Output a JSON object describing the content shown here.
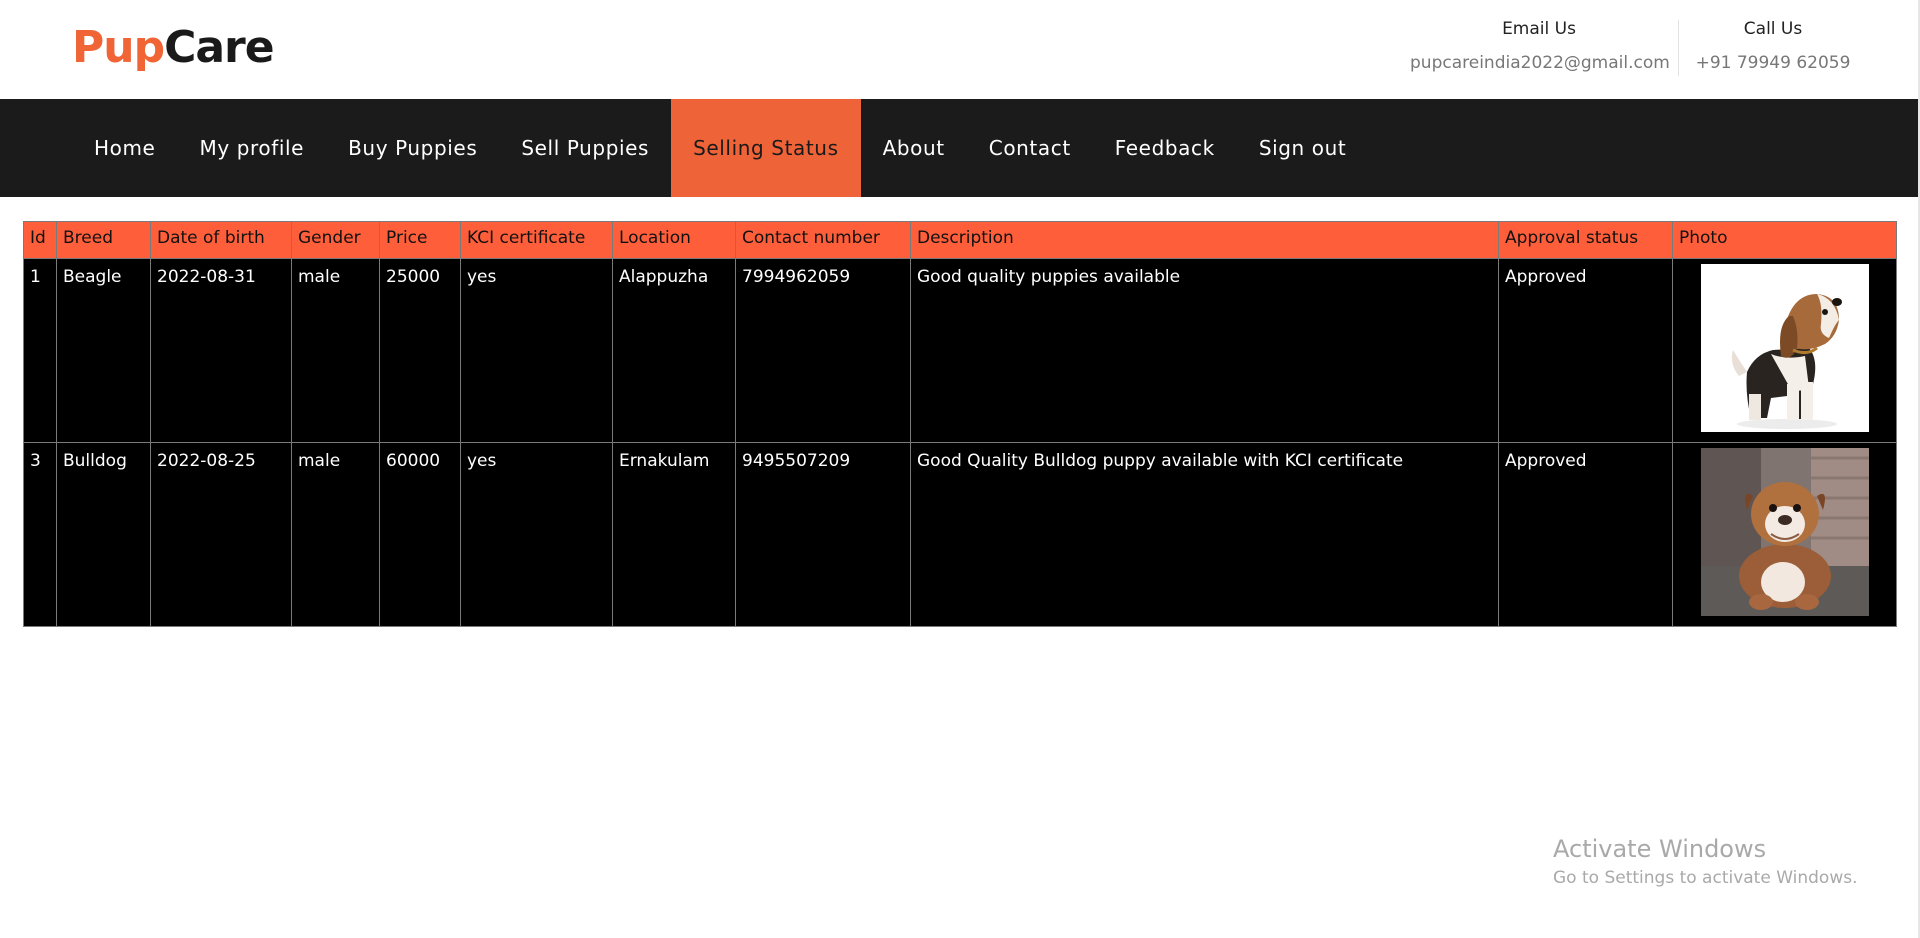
{
  "brand": {
    "part1": "Pup",
    "part2": "Care"
  },
  "contact": {
    "email_label": "Email Us",
    "email": "pupcareindia2022@gmail.com",
    "call_label": "Call Us",
    "phone": "+91 79949 62059"
  },
  "nav": {
    "items": [
      {
        "label": "Home"
      },
      {
        "label": "My profile"
      },
      {
        "label": "Buy Puppies"
      },
      {
        "label": "Sell Puppies"
      },
      {
        "label": "Selling Status",
        "active": true
      },
      {
        "label": "About"
      },
      {
        "label": "Contact"
      },
      {
        "label": "Feedback"
      },
      {
        "label": "Sign out"
      }
    ]
  },
  "table": {
    "headers": [
      "Id",
      "Breed",
      "Date of birth",
      "Gender",
      "Price",
      "KCI certificate",
      "Location",
      "Contact number",
      "Description",
      "Approval status",
      "Photo"
    ],
    "rows": [
      {
        "id": "1",
        "breed": "Beagle",
        "dob": "2022-08-31",
        "gender": "male",
        "price": "25000",
        "kci": "yes",
        "location": "Alappuzha",
        "contact": "7994962059",
        "description": "Good quality puppies available",
        "status": "Approved"
      },
      {
        "id": "3",
        "breed": "Bulldog",
        "dob": "2022-08-25",
        "gender": "male",
        "price": "60000",
        "kci": "yes",
        "location": "Ernakulam",
        "contact": "9495507209",
        "description": "Good Quality Bulldog puppy available with KCI certificate",
        "status": "Approved"
      }
    ]
  },
  "watermark": {
    "title": "Activate Windows",
    "subtitle": "Go to Settings to activate Windows."
  },
  "colors": {
    "accent": "#ff5e3a",
    "nav_active": "#ef6338",
    "nav_bg": "#1b1b1b",
    "row_bg": "#000000"
  }
}
